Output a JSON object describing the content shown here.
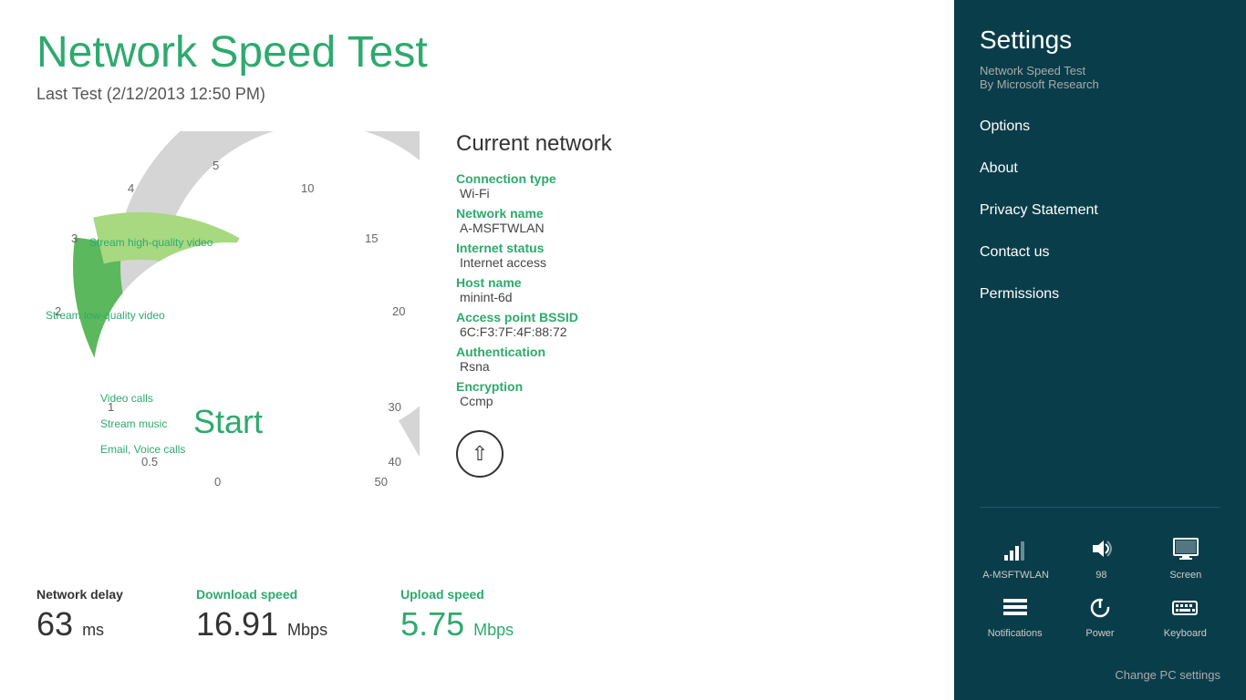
{
  "app": {
    "title": "Network Speed Test",
    "last_test": "Last Test (2/12/2013 12:50 PM)"
  },
  "gauge": {
    "start_label": "Start",
    "scale": [
      "0",
      "0.5",
      "1",
      "2",
      "3",
      "4",
      "5",
      "10",
      "15",
      "20",
      "30",
      "40",
      "50"
    ],
    "activities": [
      {
        "label": "Stream high-quality video",
        "value": 3
      },
      {
        "label": "Stream low-quality video",
        "value": 2
      },
      {
        "label": "Video calls",
        "value": 0.5
      },
      {
        "label": "Stream music",
        "value": 0.5
      },
      {
        "label": "Email, Voice calls",
        "value": 0.5
      }
    ]
  },
  "network": {
    "title": "Current network",
    "connection_type_label": "Connection type",
    "connection_type_value": "Wi-Fi",
    "network_name_label": "Network name",
    "network_name_value": "A-MSFTWLAN",
    "internet_status_label": "Internet status",
    "internet_status_value": "Internet access",
    "host_name_label": "Host name",
    "host_name_value": "minint-6d",
    "access_point_label": "Access point BSSID",
    "access_point_value": "6C:F3:7F:4F:88:72",
    "authentication_label": "Authentication",
    "authentication_value": "Rsna",
    "encryption_label": "Encryption",
    "encryption_value": "Ccmp"
  },
  "stats": {
    "network_delay_label": "Network delay",
    "network_delay_value": "63",
    "network_delay_unit": "ms",
    "download_label": "Download speed",
    "download_value": "16.91",
    "download_unit": "Mbps",
    "upload_label": "Upload speed",
    "upload_value": "5.75",
    "upload_unit": "Mbps"
  },
  "settings": {
    "title": "Settings",
    "app_name": "Network Speed Test",
    "app_publisher": "By Microsoft Research",
    "menu_items": [
      {
        "id": "options",
        "label": "Options"
      },
      {
        "id": "about",
        "label": "About"
      },
      {
        "id": "privacy",
        "label": "Privacy Statement"
      },
      {
        "id": "contact",
        "label": "Contact us"
      },
      {
        "id": "permissions",
        "label": "Permissions"
      }
    ]
  },
  "tray": {
    "row1": [
      {
        "id": "wifi",
        "icon": "wifi",
        "label": "A-MSFTWLAN"
      },
      {
        "id": "volume",
        "icon": "volume",
        "label": "98"
      },
      {
        "id": "screen",
        "icon": "screen",
        "label": "Screen"
      }
    ],
    "row2": [
      {
        "id": "notifications",
        "icon": "notifications",
        "label": "Notifications"
      },
      {
        "id": "power",
        "icon": "power",
        "label": "Power"
      },
      {
        "id": "keyboard",
        "icon": "keyboard",
        "label": "Keyboard"
      }
    ],
    "change_settings": "Change PC settings"
  }
}
